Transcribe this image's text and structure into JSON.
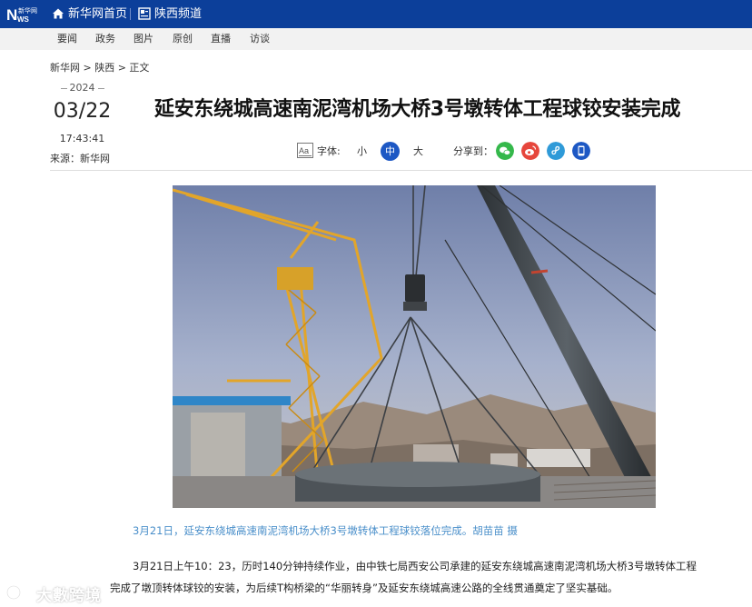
{
  "header": {
    "logo_text": "新华网 NWS",
    "nav": [
      {
        "label": "新华网首页",
        "icon": "home-icon"
      },
      {
        "label": "陕西频道",
        "icon": "channel-icon"
      }
    ]
  },
  "subnav": [
    "要闻",
    "政务",
    "图片",
    "原创",
    "直播",
    "访谈"
  ],
  "breadcrumb": "新华网 > 陕西 > 正文",
  "date": {
    "year": "2024",
    "month_day": "03/22",
    "time": "17:43:41",
    "source": "来源：新华网"
  },
  "article": {
    "title": "延安东绕城高速南泥湾机场大桥3号墩转体工程球铰安装完成",
    "font_size_label": "字体:",
    "font_sizes": [
      "小",
      "中",
      "大"
    ],
    "font_size_selected": "中",
    "share_label": "分享到：",
    "share_icons": [
      "wechat-icon",
      "weibo-icon",
      "mini-program-icon",
      "client-icon"
    ],
    "caption": "3月21日，延安东绕城高速南泥湾机场大桥3号墩转体工程球铰落位完成。胡苗苗 摄",
    "paragraph_lines": [
      "3月21日上午10：23，历时140分钟持续作业，由中铁七局西安公司承建的延安东绕城高速南泥湾机场大桥3号墩转体工程",
      "完成了墩顶转体球铰的安装，为后续T构桥梁的“华丽转身”及延安东绕城高速公路的全线贯通奠定了坚实基础。"
    ]
  },
  "watermark": "大數跨境",
  "colors": {
    "header_bg": "#0c3f9a",
    "accent": "#1d58c4",
    "caption": "#4a8fca",
    "wechat": "#35b84b",
    "weibo": "#e6463c",
    "mini": "#2f9ad8",
    "client": "#1d58c4"
  }
}
